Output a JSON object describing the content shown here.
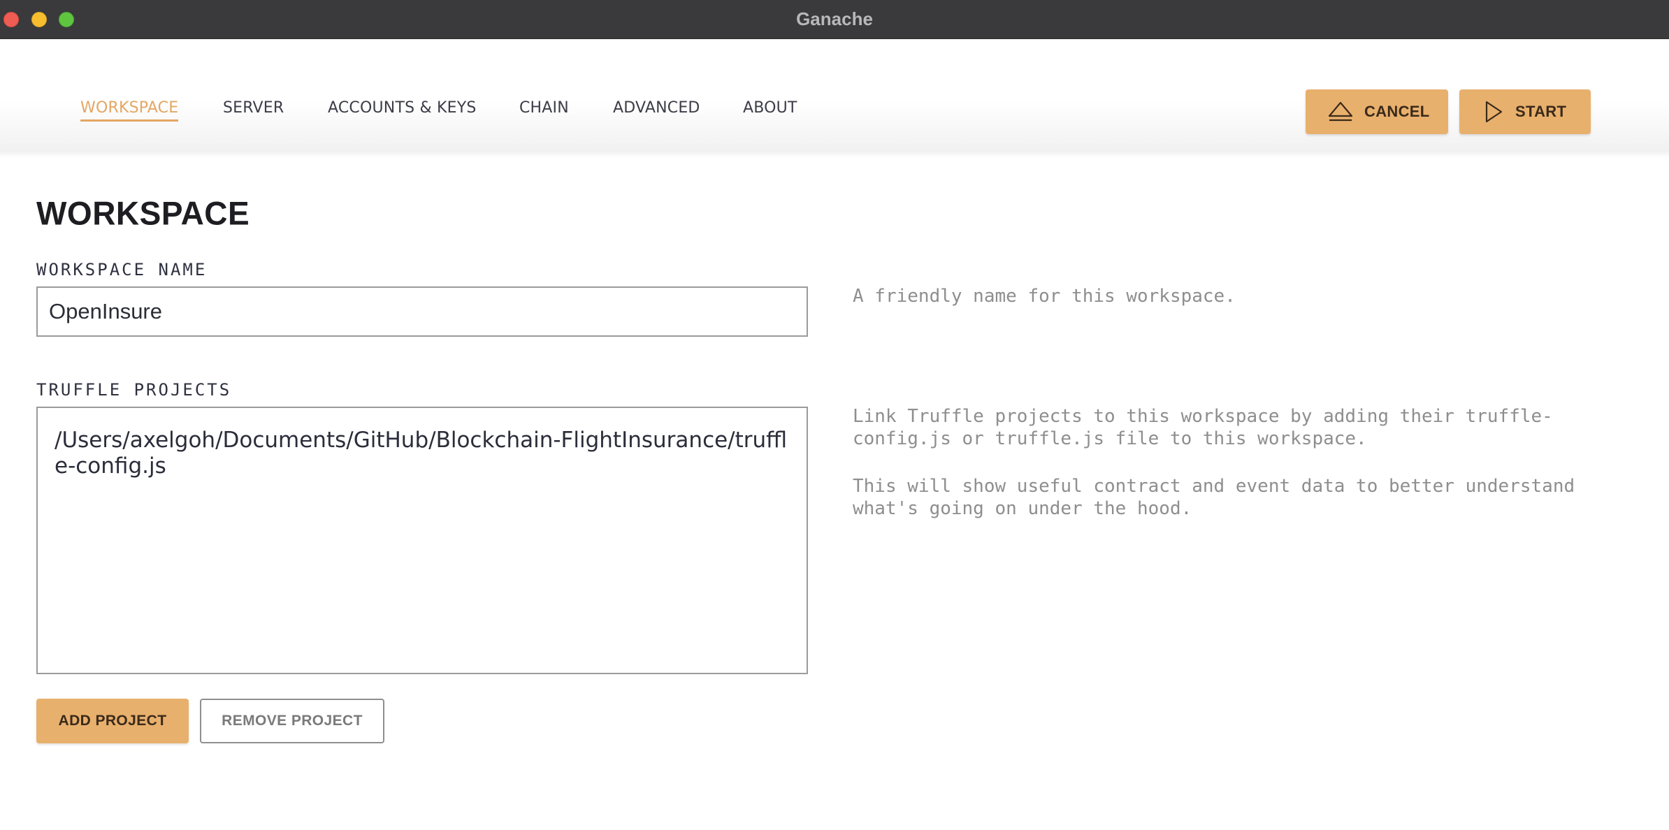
{
  "window": {
    "title": "Ganache",
    "controls": [
      "close",
      "minimize",
      "maximize"
    ]
  },
  "nav": {
    "tabs": [
      {
        "label": "WORKSPACE",
        "active": true
      },
      {
        "label": "SERVER",
        "active": false
      },
      {
        "label": "ACCOUNTS & KEYS",
        "active": false
      },
      {
        "label": "CHAIN",
        "active": false
      },
      {
        "label": "ADVANCED",
        "active": false
      },
      {
        "label": "ABOUT",
        "active": false
      }
    ],
    "cancel_label": "CANCEL",
    "cancel_icon": "eject-icon",
    "start_label": "START",
    "start_icon": "play-icon"
  },
  "workspace": {
    "title": "WORKSPACE",
    "name_label": "WORKSPACE NAME",
    "name_value": "OpenInsure",
    "name_help": "A friendly name for this workspace.",
    "projects_label": "TRUFFLE PROJECTS",
    "projects": [
      "/Users/axelgoh/Documents/GitHub/Blockchain-FlightInsurance/truffle-config.js"
    ],
    "projects_help_1": "Link Truffle projects to this workspace by adding their truffle-config.js or truffle.js file to this workspace.",
    "projects_help_2": "This will show useful contract and event data to better understand what's going on under the hood.",
    "add_project_label": "ADD PROJECT",
    "remove_project_label": "REMOVE PROJECT"
  },
  "colors": {
    "accent": "#e8b06d",
    "active_tab": "#e4a663",
    "titlebar": "#3a3a3c",
    "help_text": "#8e8e8e"
  }
}
